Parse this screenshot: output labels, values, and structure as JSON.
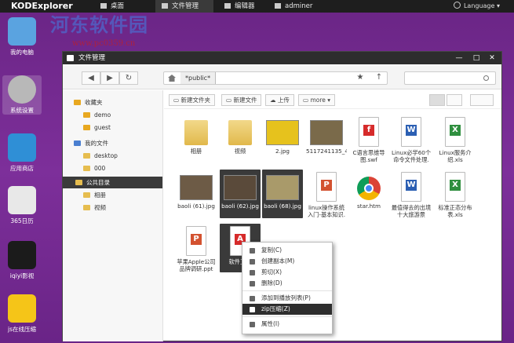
{
  "topbar": {
    "brand": "KODExplorer",
    "nav": [
      "桌面",
      "文件管理",
      "编辑器",
      "adminer"
    ],
    "language": "Language"
  },
  "watermark": {
    "text": "河东软件园",
    "url": "www.pc0359.cn"
  },
  "desktop_icons": [
    {
      "label": "我的电脑",
      "icon": "computer-icon",
      "color": "#5aa3e0"
    },
    {
      "label": "系统设置",
      "icon": "gear-icon",
      "color": "#b8b8b8"
    },
    {
      "label": "应用商店",
      "icon": "store-icon",
      "color": "#2f8fd6"
    },
    {
      "label": "365日历",
      "icon": "calendar-icon",
      "color": "#e8e8e8"
    },
    {
      "label": "iqiyi影视",
      "icon": "iqiyi-icon",
      "color": "#1b1b1b"
    },
    {
      "label": "js在线压缩",
      "icon": "js-icon",
      "color": "#f5c518"
    }
  ],
  "window": {
    "title": "文件管理",
    "minimize": "—",
    "maximize": "□",
    "close": "✕"
  },
  "toolbar": {
    "back": "◀",
    "forward": "▶",
    "refresh": "↻",
    "path": "*public*",
    "star": "★",
    "up": "↑"
  },
  "sidebar": [
    {
      "label": "收藏夹",
      "icon": "star-icon",
      "level": 0
    },
    {
      "label": "demo",
      "icon": "star-icon",
      "level": 1
    },
    {
      "label": "guest",
      "icon": "star-icon",
      "level": 1
    },
    {
      "label": "我的文件",
      "icon": "user-icon",
      "level": 0
    },
    {
      "label": "desktop",
      "icon": "folder-icon",
      "level": 1
    },
    {
      "label": "000",
      "icon": "folder-icon",
      "level": 1
    },
    {
      "label": "公共目录",
      "icon": "folder-icon",
      "level": 0,
      "selected": true
    },
    {
      "label": "相册",
      "icon": "folder-icon",
      "level": 1
    },
    {
      "label": "视频",
      "icon": "folder-icon",
      "level": 1
    }
  ],
  "actions": {
    "new_folder": "新建文件夹",
    "new_file": "新建文件",
    "upload": "上传",
    "more": "more"
  },
  "files": [
    {
      "name": "相册",
      "type": "folder"
    },
    {
      "name": "视频",
      "type": "folder"
    },
    {
      "name": "2.jpg",
      "type": "image",
      "color": "#e6c21d"
    },
    {
      "name": "5117241135_4f28e29743_z",
      "type": "image",
      "color": "#7a6a4a"
    },
    {
      "name": "C语言思维导图.swf",
      "type": "swf",
      "color": "#d62b2b",
      "badge": "f"
    },
    {
      "name": "Linux必学60个命令文件处理.",
      "type": "word",
      "color": "#2b5fb3",
      "badge": "W"
    },
    {
      "name": "Linux服务介绍.xls",
      "type": "excel",
      "color": "#2f8f3f",
      "badge": "X"
    },
    {
      "name": "baoli (61).jpg",
      "type": "image",
      "color": "#6d5b46"
    },
    {
      "name": "baoli (62).jpg",
      "type": "image",
      "color": "#5a4a3a",
      "selected": true
    },
    {
      "name": "baoli (68).jpg",
      "type": "image",
      "color": "#a99a6a",
      "selected": true
    },
    {
      "name": "linux操作系统入门-基本知识.",
      "type": "ppt",
      "color": "#d35230",
      "badge": "P"
    },
    {
      "name": "star.htm",
      "type": "chrome",
      "color": "#4285f4"
    },
    {
      "name": "最值得去的出境十大旅游景",
      "type": "word",
      "color": "#2b5fb3",
      "badge": "W"
    },
    {
      "name": "标准正态分布表.xls",
      "type": "excel",
      "color": "#2f8f3f",
      "badge": "X"
    },
    {
      "name": "苹果Apple公司品牌调研.ppt",
      "type": "ppt",
      "color": "#d35230",
      "badge": "P"
    },
    {
      "name": "软件工程",
      "type": "pdf",
      "color": "#d62b2b",
      "badge": "A",
      "selected": true
    }
  ],
  "context_menu": [
    {
      "label": "复制(C)",
      "icon": "copy-icon"
    },
    {
      "label": "创建副本(M)",
      "icon": "duplicate-icon"
    },
    {
      "label": "剪切(X)",
      "icon": "cut-icon"
    },
    {
      "label": "删除(D)",
      "icon": "trash-icon"
    },
    {
      "sep": true
    },
    {
      "label": "添加到播放列表(P)",
      "icon": "music-icon"
    },
    {
      "label": "zip压缩(Z)",
      "icon": "folder-zip-icon",
      "highlight": true
    },
    {
      "sep": true
    },
    {
      "label": "属性(I)",
      "icon": "info-icon"
    }
  ]
}
